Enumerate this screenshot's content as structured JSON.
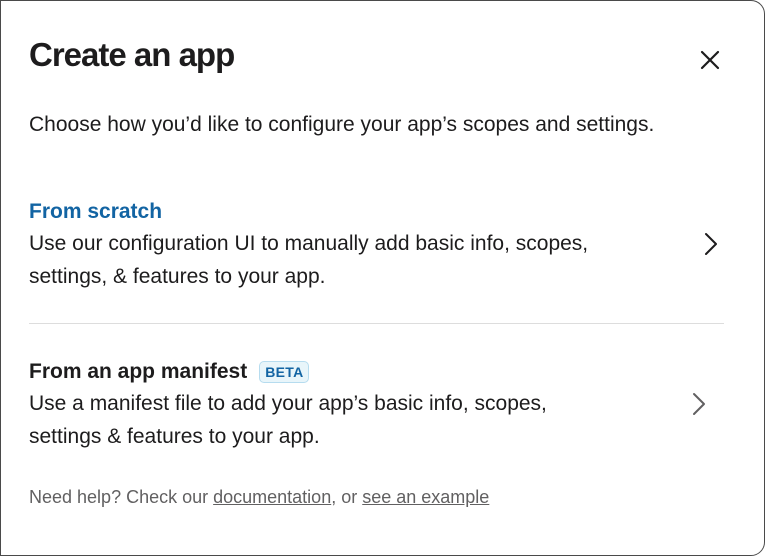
{
  "modal": {
    "title": "Create an app",
    "subtitle": "Choose how you’d like to configure your app’s scopes and settings.",
    "close_icon": "close-icon"
  },
  "options": [
    {
      "title": "From scratch",
      "description_line1": "Use our configuration UI to manually add basic info, scopes,",
      "description_line2": "settings, & features to your app.",
      "icon": "chevron-right-icon"
    },
    {
      "title": "From an app manifest",
      "badge": "BETA",
      "description_line1": "Use a manifest file to add your app’s basic info, scopes,",
      "description_line2": "settings & features to your app.",
      "icon": "chevron-right-icon"
    }
  ],
  "help": {
    "prefix": "Need help? Check our ",
    "documentation_link": "documentation",
    "middle": ", or ",
    "example_link": "see an example"
  },
  "colors": {
    "link_blue": "#1264a3",
    "text": "#1d1c1d",
    "muted": "#616061",
    "divider": "#dddddd",
    "badge_bg": "#e8f5fa"
  }
}
